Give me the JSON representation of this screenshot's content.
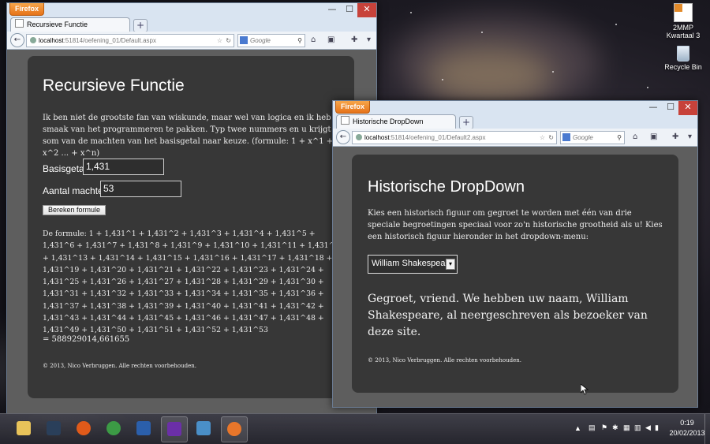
{
  "desktop": {
    "icons": [
      {
        "label_line1": "2MMP",
        "label_line2": "Kwartaal 3",
        "icon": "file-icon"
      },
      {
        "label_line1": "Recycle Bin",
        "label_line2": "",
        "icon": "recycle-bin-icon"
      }
    ]
  },
  "window1": {
    "firefox_button": "Firefox",
    "tab_title": "Recursieve Functie",
    "new_tab": "+",
    "url_host": "localhost",
    "url_rest": ":51814/oefening_01/Default.aspx",
    "search_engine_placeholder": "Google",
    "controls": {
      "minimize": "—",
      "maximize": "☐",
      "close": "✕"
    },
    "page": {
      "title": "Recursieve Functie",
      "intro": "Ik ben niet de grootste fan van wiskunde, maar wel van logica en ik heb de smaak van het programmeren te pakken. Typ twee nummers en u krijgt de som van de machten van het basisgetal naar keuze. (formule: 1 + x^1 + x^2 ... + x^n)",
      "base_label": "Basisgetal:",
      "base_value": "1,431",
      "power_label": "Aantal machten:",
      "power_value": "53",
      "button_label": "Bereken formule",
      "formula": "De formule: 1 + 1,431^1 + 1,431^2 + 1,431^3 + 1,431^4 + 1,431^5 + 1,431^6 + 1,431^7 + 1,431^8 + 1,431^9 + 1,431^10 + 1,431^11 + 1,431^12 + 1,431^13 + 1,431^14 + 1,431^15 + 1,431^16 + 1,431^17 + 1,431^18 + 1,431^19 + 1,431^20 + 1,431^21 + 1,431^22 + 1,431^23 + 1,431^24 + 1,431^25 + 1,431^26 + 1,431^27 + 1,431^28 + 1,431^29 + 1,431^30 + 1,431^31 + 1,431^32 + 1,431^33 + 1,431^34 + 1,431^35 + 1,431^36 + 1,431^37 + 1,431^38 + 1,431^39 + 1,431^40 + 1,431^41 + 1,431^42 + 1,431^43 + 1,431^44 + 1,431^45 + 1,431^46 + 1,431^47 + 1,431^48 + 1,431^49 + 1,431^50 + 1,431^51 + 1,431^52 + 1,431^53",
      "result": "= 588929014,661655",
      "footer": "© 2013, Nico Verbruggen. Alle rechten voorbehouden."
    }
  },
  "window2": {
    "firefox_button": "Firefox",
    "tab_title": "Historische DropDown",
    "new_tab": "+",
    "url_host": "localhost",
    "url_rest": ":51814/oefening_01/Default2.aspx",
    "search_engine_placeholder": "Google",
    "controls": {
      "minimize": "—",
      "maximize": "☐",
      "close": "✕"
    },
    "page": {
      "title": "Historische DropDown",
      "intro": "Kies een historisch figuur om gegroet te worden met één van drie speciale begroetingen speciaal voor zo'n historische grootheid als u! Kies een historisch figuur hieronder in het dropdown-menu:",
      "selected_figure": "William Shakespeare",
      "greeting": "Gegroet, vriend. We hebben uw naam, William Shakespeare, al neergeschreven als bezoeker van deze site.",
      "footer": "© 2013, Nico Verbruggen. Alle rechten voorbehouden."
    }
  },
  "taskbar": {
    "apps": [
      {
        "name": "file-explorer-icon",
        "color": "#e8c35a"
      },
      {
        "name": "steam-icon",
        "color": "#2a3f5a"
      },
      {
        "name": "media-player-icon",
        "color": "#e05a1a"
      },
      {
        "name": "chrome-icon",
        "color": "#3c9a45"
      },
      {
        "name": "word-icon",
        "color": "#2b5fab"
      },
      {
        "name": "visual-studio-icon",
        "color": "#6b2fa8"
      },
      {
        "name": "remote-desktop-icon",
        "color": "#4a8fc8"
      },
      {
        "name": "firefox-icon",
        "color": "#e8762a"
      }
    ],
    "time": "0:19",
    "date": "20/02/2013"
  }
}
